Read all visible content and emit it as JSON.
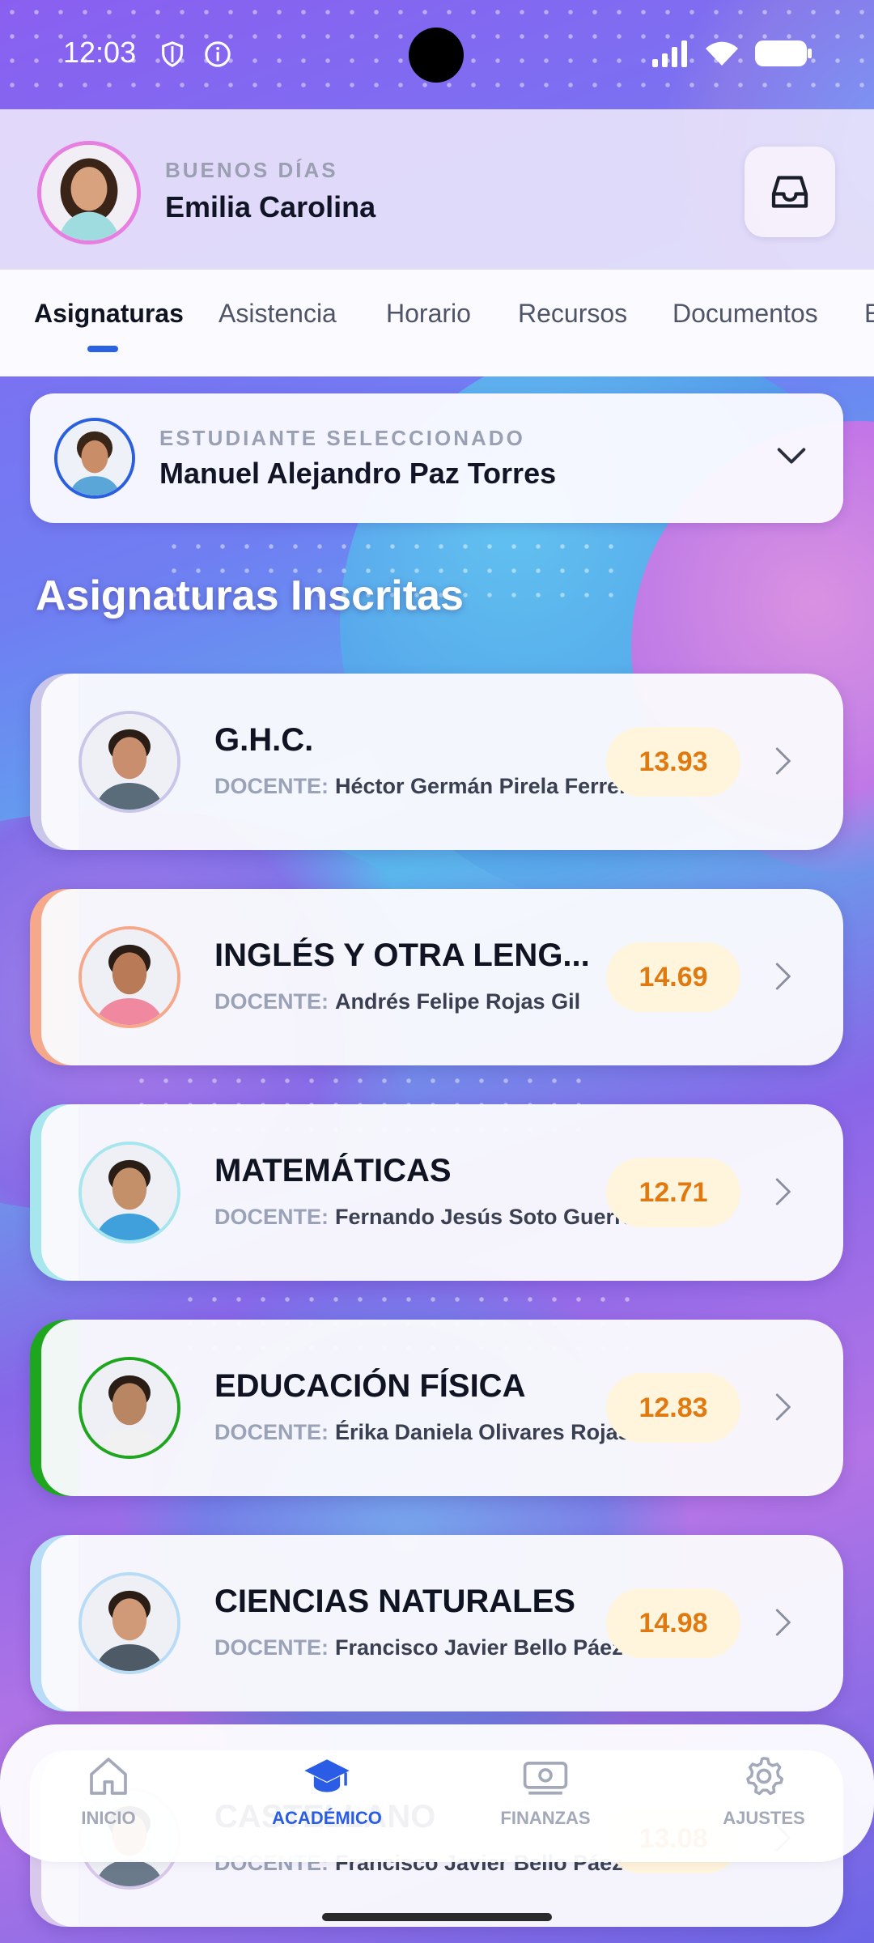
{
  "status_bar": {
    "time": "12:03"
  },
  "header": {
    "greeting": "BUENOS DÍAS",
    "user_name": "Emilia Carolina"
  },
  "tabs": [
    {
      "label": "Asignaturas",
      "active": true
    },
    {
      "label": "Asistencia"
    },
    {
      "label": "Horario"
    },
    {
      "label": "Recursos"
    },
    {
      "label": "Documentos"
    },
    {
      "label": "E"
    }
  ],
  "student_selector": {
    "label": "ESTUDIANTE SELECCIONADO",
    "name": "Manuel Alejandro Paz Torres"
  },
  "section_title": "Asignaturas Inscritas",
  "teacher_label": "DOCENTE:",
  "subjects": [
    {
      "name": "G.H.C.",
      "teacher": "Héctor Germán Pirela Ferrer",
      "grade": "13.93",
      "accent": "#c9c6ea"
    },
    {
      "name": "INGLÉS Y OTRA LENG...",
      "teacher": "Andrés Felipe Rojas Gil",
      "grade": "14.69",
      "accent": "#f5a98a"
    },
    {
      "name": "MATEMÁTICAS",
      "teacher": "Fernando Jesús Soto Guerra",
      "grade": "12.71",
      "accent": "#a8e6ee"
    },
    {
      "name": "EDUCACIÓN FÍSICA",
      "teacher": "Érika Daniela Olivares Rojas",
      "grade": "12.83",
      "accent": "#1fa61f"
    },
    {
      "name": "CIENCIAS NATURALES",
      "teacher": "Francisco Javier Bello Páez",
      "grade": "14.98",
      "accent": "#b8dcf6"
    },
    {
      "name": "CASTELLANO",
      "teacher": "Francisco Javier Bello Páez",
      "grade": "13.08",
      "accent": "#d8c8ec"
    }
  ],
  "bottom_nav": [
    {
      "label": "INICIO",
      "icon": "home-icon"
    },
    {
      "label": "ACADÉMICO",
      "icon": "graduation-cap-icon",
      "active": true
    },
    {
      "label": "FINANZAS",
      "icon": "money-icon"
    },
    {
      "label": "AJUSTES",
      "icon": "gear-icon"
    }
  ],
  "colors": {
    "accent_blue": "#2a5ce6",
    "grade_orange": "#e07a10",
    "grade_bg": "#fff4dc"
  }
}
